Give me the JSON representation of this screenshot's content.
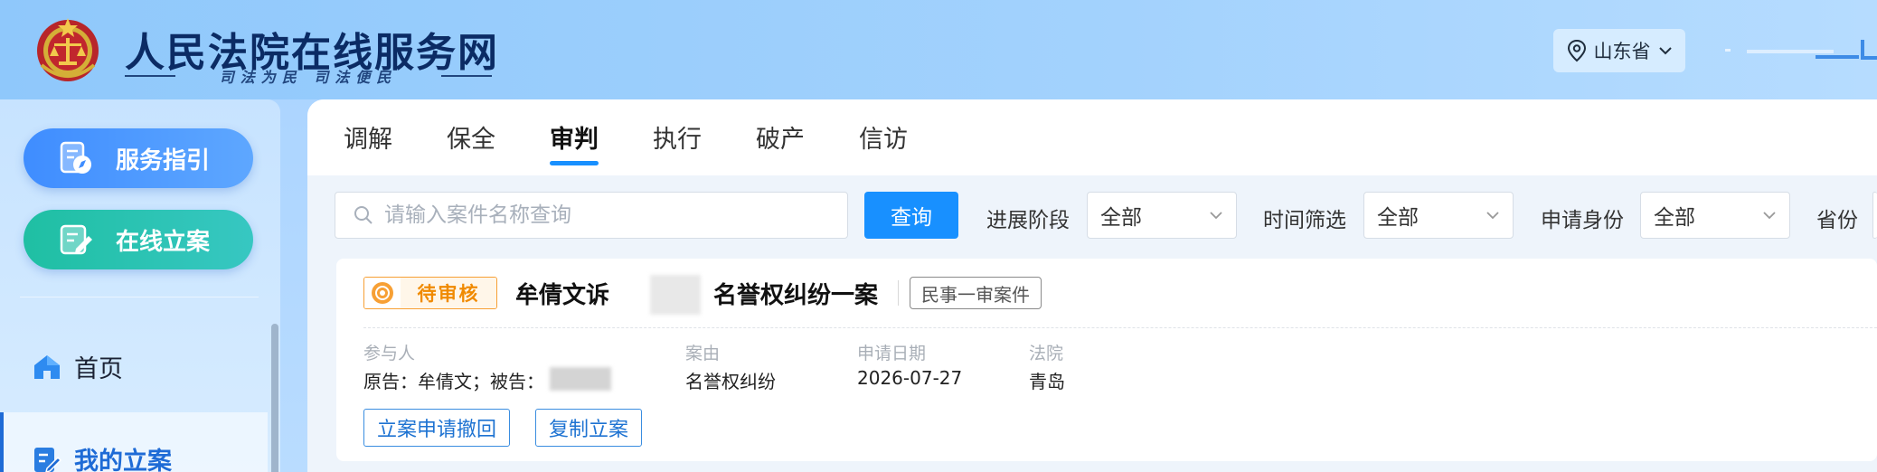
{
  "header": {
    "site_title": "人民法院在线服务网",
    "slogan": "司法为民 司法便民",
    "region": "山东省"
  },
  "sidebar": {
    "guide_label": "服务指引",
    "file_label": "在线立案",
    "nav": [
      {
        "label": "首页"
      },
      {
        "label": "我的立案",
        "active": true
      }
    ]
  },
  "tabs": [
    {
      "label": "调解"
    },
    {
      "label": "保全"
    },
    {
      "label": "审判",
      "active": true
    },
    {
      "label": "执行"
    },
    {
      "label": "破产"
    },
    {
      "label": "信访"
    }
  ],
  "filters": {
    "search_placeholder": "请输入案件名称查询",
    "query_label": "查询",
    "stage_label": "进展阶段",
    "stage_value": "全部",
    "time_label": "时间筛选",
    "time_value": "全部",
    "identity_label": "申请身份",
    "identity_value": "全部",
    "province_label": "省份"
  },
  "case": {
    "status": "待审核",
    "title_part1": "牟倩文诉",
    "title_part2": "名誉权纠纷一案",
    "type": "民事一审案件",
    "participants_label": "参与人",
    "participants_value": "原告：牟倩文；被告：",
    "cause_label": "案由",
    "cause_value": "名誉权纠纷",
    "date_label": "申请日期",
    "date_value": "2026-07-27",
    "court_label": "法院",
    "court_value": "青岛",
    "withdraw_label": "立案申请撤回",
    "copy_label": "复制立案"
  },
  "colors": {
    "primary": "#1890ff",
    "status_orange": "#f08a00",
    "guide_btn": "#3f8dff",
    "file_btn": "#1fbfa3"
  }
}
